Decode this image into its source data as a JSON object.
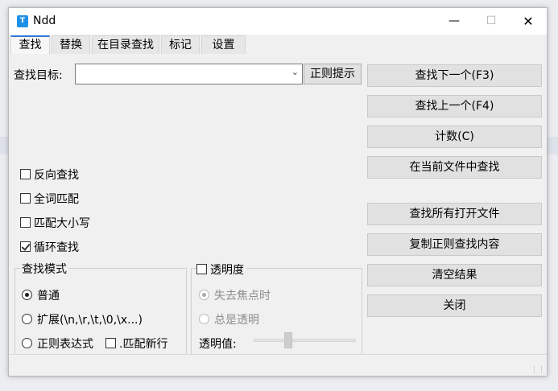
{
  "window": {
    "title": "Ndd",
    "icon_letter": "T"
  },
  "tabs": [
    "查找",
    "替换",
    "在目录查找",
    "标记",
    "设置"
  ],
  "find": {
    "target_label": "查找目标:",
    "target_value": "",
    "regex_hint_button": "正则提示"
  },
  "options": [
    {
      "label": "反向查找",
      "checked": false
    },
    {
      "label": "全词匹配",
      "checked": false
    },
    {
      "label": "匹配大小写",
      "checked": false
    },
    {
      "label": "循环查找",
      "checked": true
    }
  ],
  "search_mode": {
    "title": "查找模式",
    "modes": [
      "普通",
      "扩展(\\n,\\r,\\t,\\0,\\x...)",
      "正则表达式"
    ],
    "selected": 0,
    "match_newline_label": ".匹配新行"
  },
  "transparency": {
    "title": "透明度",
    "checked": false,
    "options": [
      "失去焦点时",
      "总是透明"
    ],
    "selected": 0,
    "value_label": "透明值:",
    "level": 0.3
  },
  "buttons": {
    "find_next": "查找下一个(F3)",
    "find_prev": "查找上一个(F4)",
    "count": "计数(C)",
    "find_in_current": "在当前文件中查找",
    "find_in_all_open": "查找所有打开文件",
    "copy_regex_results": "复制正则查找内容",
    "clear_results": "清空结果",
    "close": "关闭"
  }
}
